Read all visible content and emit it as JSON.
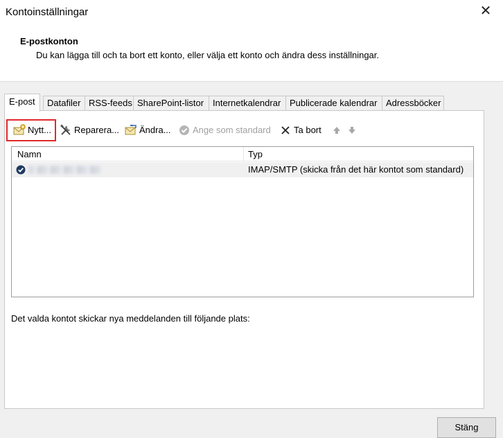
{
  "window": {
    "title": "Kontoinställningar",
    "close_glyph": "✕"
  },
  "section": {
    "title": "E-postkonton",
    "description": "Du kan lägga till och ta bort ett konto, eller välja ett konto och ändra dess inställningar."
  },
  "tabs": [
    {
      "label": "E-post",
      "active": true
    },
    {
      "label": "Datafiler"
    },
    {
      "label": "RSS-feeds"
    },
    {
      "label": "SharePoint-listor"
    },
    {
      "label": "Internetkalendrar"
    },
    {
      "label": "Publicerade kalendrar"
    },
    {
      "label": "Adressböcker"
    }
  ],
  "toolbar": {
    "new_label": "Nytt...",
    "repair_label": "Reparera...",
    "change_label": "Ändra...",
    "default_label": "Ange som standard",
    "remove_label": "Ta bort",
    "up_glyph": "🡅",
    "down_glyph": "🡇"
  },
  "accounts": {
    "columns": {
      "name": "Namn",
      "type": "Typ"
    },
    "rows": [
      {
        "name": "",
        "type": "IMAP/SMTP (skicka från det här kontot som standard)"
      }
    ]
  },
  "info_text": "Det valda kontot skickar nya meddelanden till följande plats:",
  "footer": {
    "close_label": "Stäng"
  },
  "colors": {
    "highlight": "#e0292b",
    "default_check": "#1f3a60"
  },
  "icons": [
    "new-account-icon",
    "repair-icon",
    "change-icon",
    "set-default-icon",
    "remove-icon",
    "move-up-icon",
    "move-down-icon",
    "default-account-check-icon"
  ]
}
